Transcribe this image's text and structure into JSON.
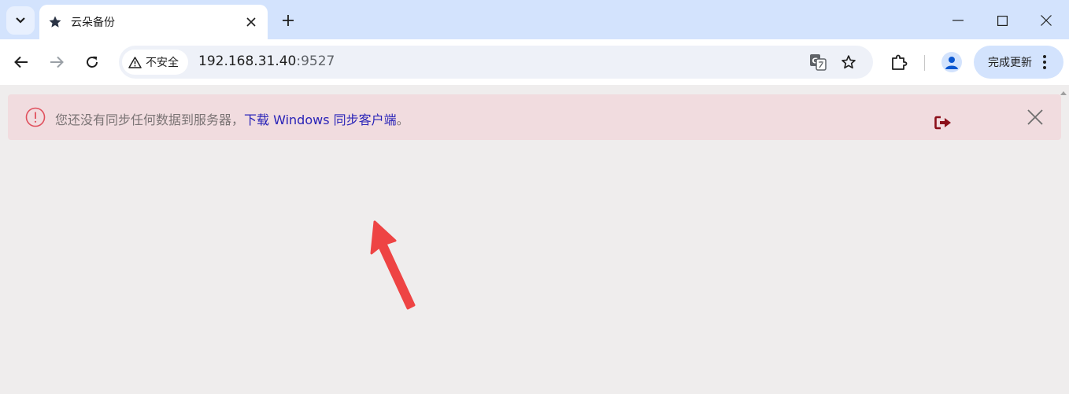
{
  "tab": {
    "title": "云朵备份"
  },
  "toolbar": {
    "security_label": "不安全",
    "url_host": "192.168.31.40",
    "url_port": ":9527",
    "update_label": "完成更新"
  },
  "alert": {
    "message_prefix": "您还没有同步任何数据到服务器，",
    "link_text": "下载 Windows 同步客户端",
    "message_suffix": "。"
  },
  "icons": {
    "tab_search": "chevron-down-icon",
    "favicon": "star-icon",
    "tab_close": "close-icon",
    "new_tab": "plus-icon",
    "back": "arrow-left-icon",
    "forward": "arrow-right-icon",
    "reload": "reload-icon",
    "warning": "warning-triangle-icon",
    "translate": "translate-icon",
    "bookmark": "star-outline-icon",
    "extensions": "puzzle-icon",
    "profile": "person-icon",
    "menu": "kebab-icon",
    "alert": "exclamation-circle-icon",
    "logout": "sign-out-icon",
    "alert_close": "close-icon"
  },
  "colors": {
    "tabstrip": "#d3e3fd",
    "alert_bg": "#f1dcdf",
    "alert_icon": "#e0505d",
    "link": "#2a24b8",
    "logout": "#8b0f1a",
    "annotation_arrow": "#ee4444"
  }
}
